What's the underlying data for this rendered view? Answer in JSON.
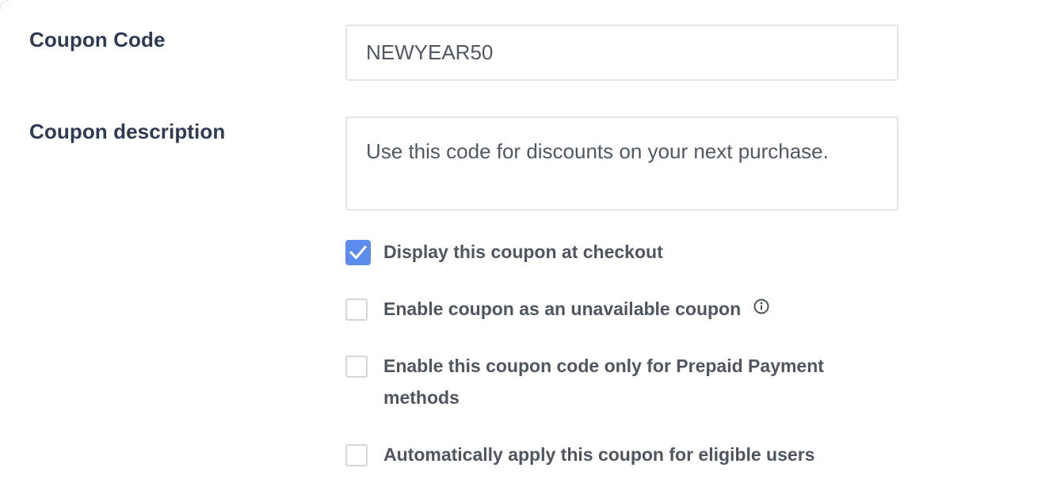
{
  "form": {
    "code_label": "Coupon Code",
    "code_value": "NEWYEAR50",
    "description_label": "Coupon description",
    "description_value": "Use this code for discounts on your next purchase."
  },
  "options": [
    {
      "label": "Display this coupon at checkout",
      "checked": true
    },
    {
      "label": "Enable coupon as an unavailable coupon",
      "checked": false,
      "info_icon": "info-circle-icon"
    },
    {
      "label": "Enable this coupon code only for Prepaid Payment methods",
      "checked": false
    },
    {
      "label": "Automatically apply this coupon for eligible users",
      "checked": false
    }
  ],
  "colors": {
    "accent": "#5b8def",
    "label_text": "#2e3b55",
    "option_text": "#4f5661"
  }
}
